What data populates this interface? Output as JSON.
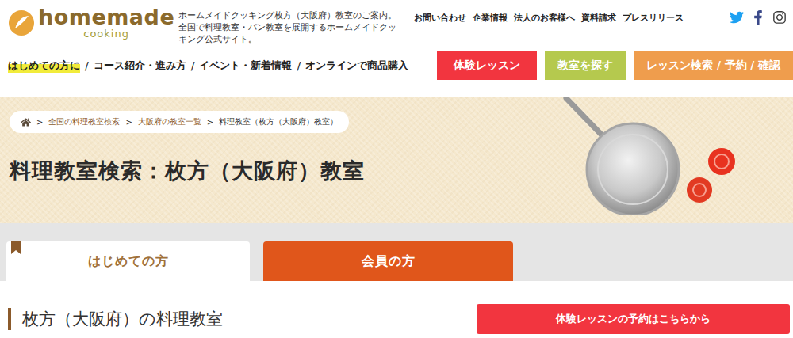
{
  "header": {
    "logo": {
      "main": "homemade",
      "sub": "cooking"
    },
    "description": "ホームメイドクッキング枚方（大阪府）教室のご案内。全国で料理教室・パン教室を展開するホームメイドクッキング公式サイト。",
    "top_links": [
      "お問い合わせ",
      "企業情報",
      "法人のお客様へ",
      "資料請求",
      "プレスリリース"
    ]
  },
  "nav": {
    "separator": "/",
    "items": [
      {
        "label": "はじめての方に",
        "highlighted": true
      },
      {
        "label": "コース紹介・進み方",
        "highlighted": false
      },
      {
        "label": "イベント・新着情報",
        "highlighted": false
      },
      {
        "label": "オンラインで商品購入",
        "highlighted": false
      }
    ]
  },
  "action_buttons": [
    {
      "label": "体験レッスン",
      "color": "#f2353f"
    },
    {
      "label": "教室を探す",
      "color": "#b5c94e"
    },
    {
      "label": "レッスン検索 / 予約 / 確認",
      "color": "#ef9d4d"
    }
  ],
  "breadcrumb": {
    "separator": ">",
    "items": [
      "全国の料理教室検索",
      "大阪府の教室一覧",
      "料理教室（枚方（大阪府）教室）"
    ]
  },
  "page_title": "料理教室検索：枚方（大阪府）教室",
  "tabs": [
    {
      "label": "はじめての方",
      "selected": true
    },
    {
      "label": "会員の方",
      "selected": false
    }
  ],
  "section": {
    "heading": "枚方（大阪府）の料理教室",
    "button": "体験レッスンの予約はこちらから"
  }
}
